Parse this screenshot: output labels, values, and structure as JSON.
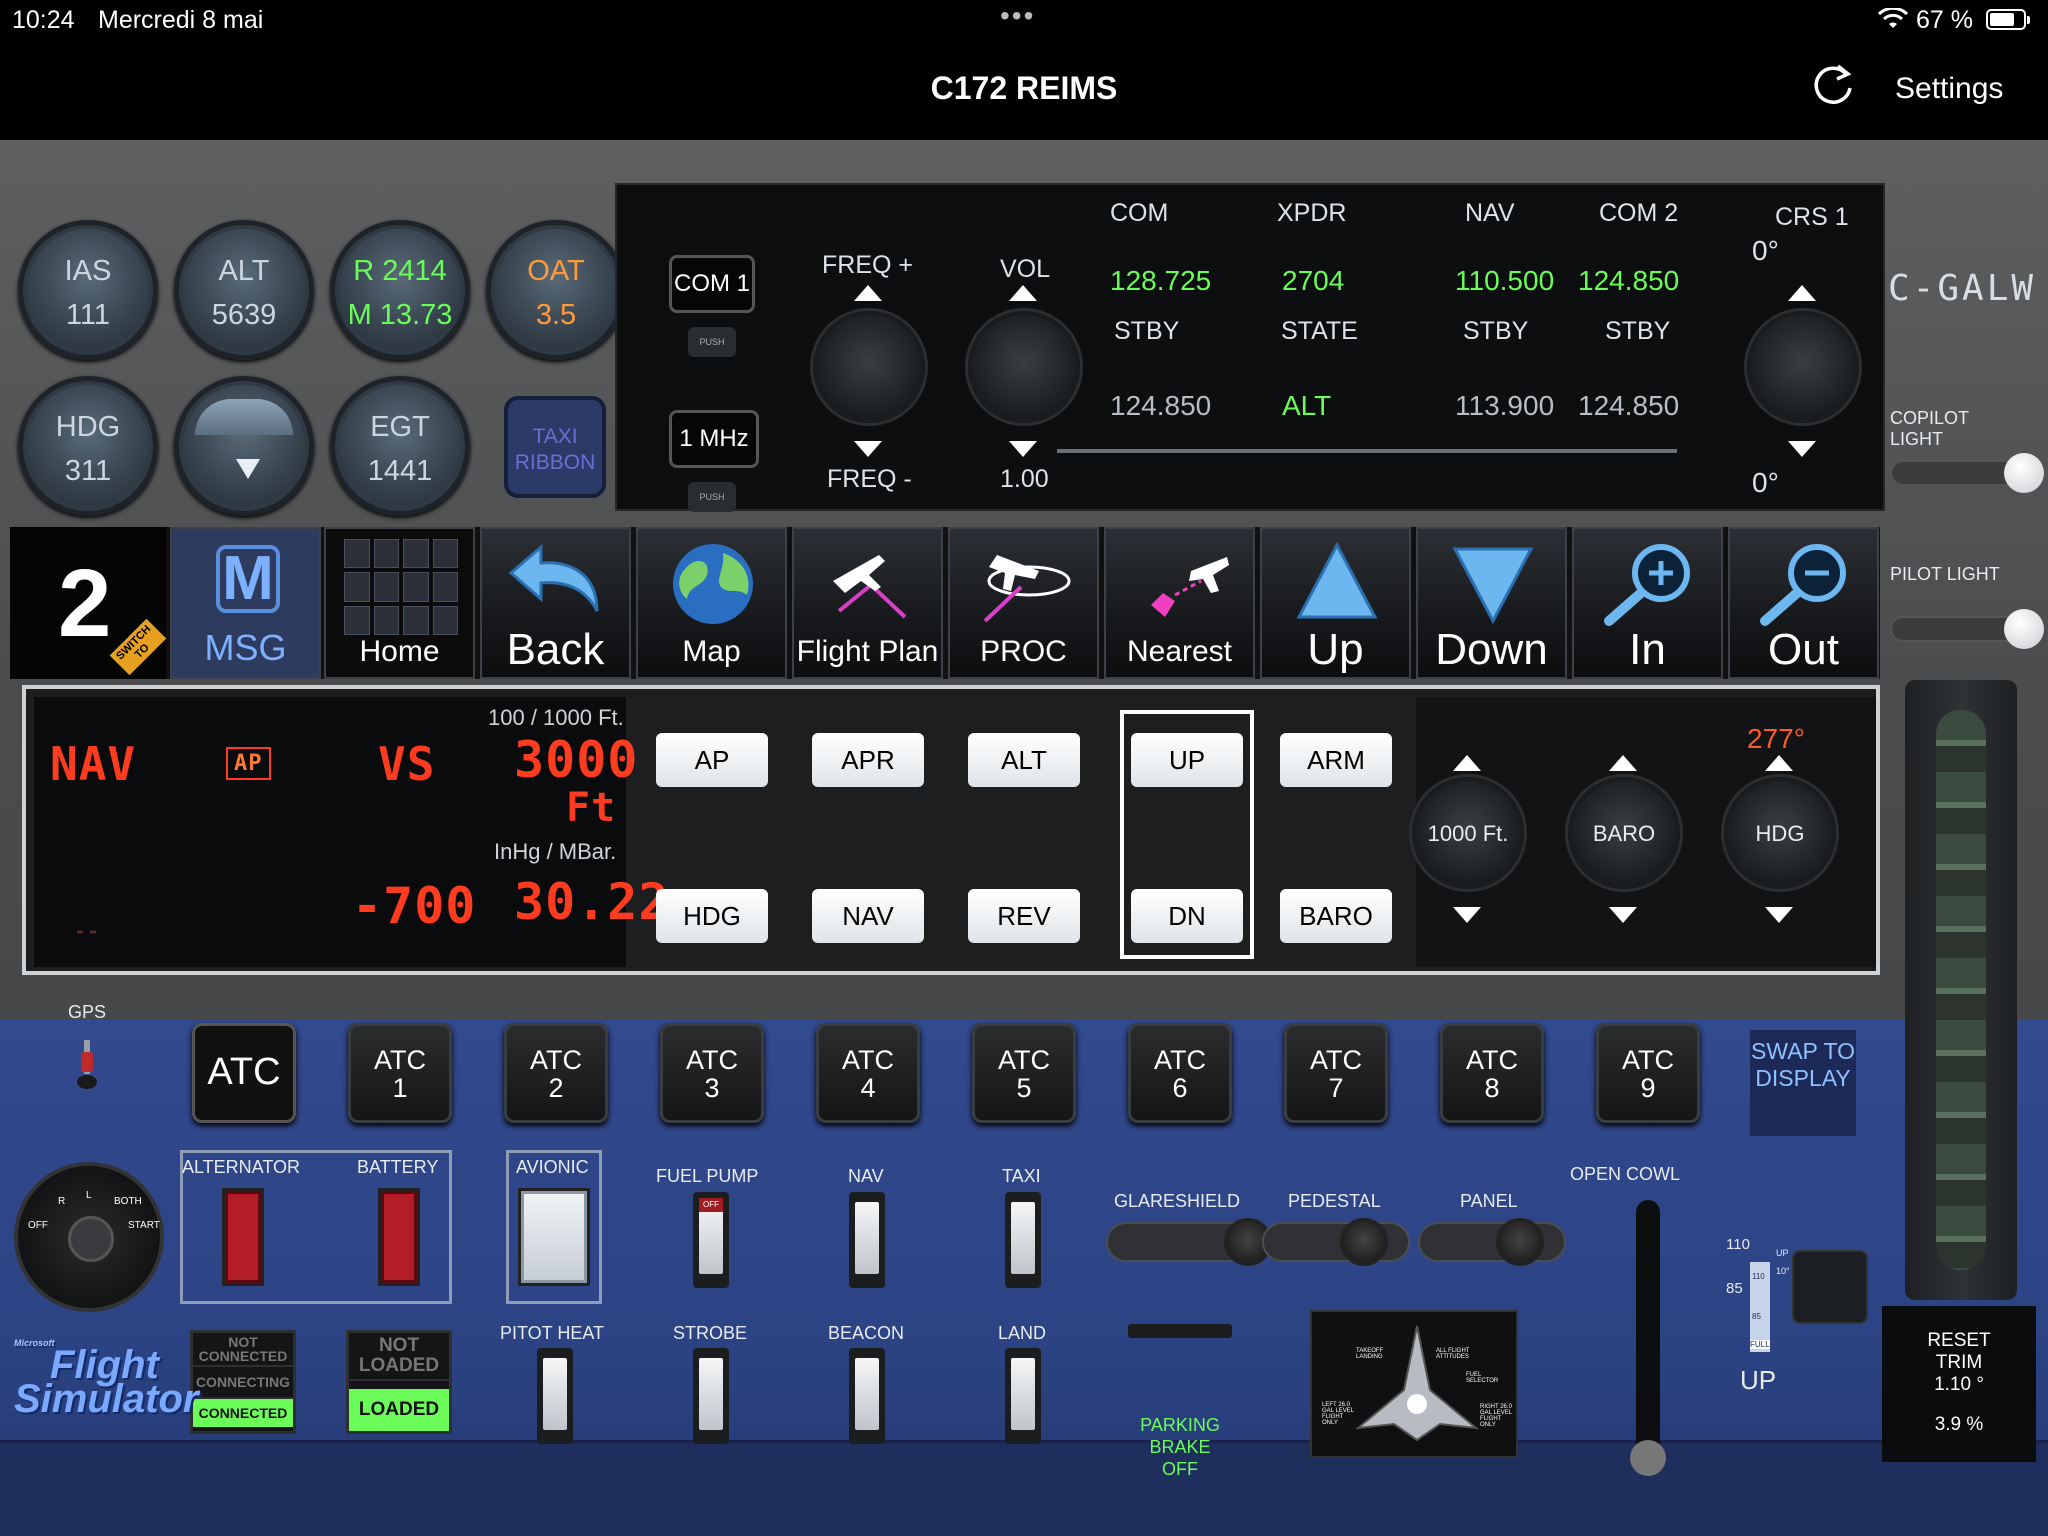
{
  "status": {
    "time": "10:24",
    "date": "Mercredi 8 mai",
    "battery": "67 %"
  },
  "nav": {
    "title": "C172 REIMS",
    "settings": "Settings"
  },
  "gauges": {
    "ias_label": "IAS",
    "ias_value": "111",
    "alt_label": "ALT",
    "alt_value": "5639",
    "r_value": "R 2414",
    "m_value": "M 13.73",
    "oat_label": "OAT",
    "oat_value": "3.5",
    "hdg_label": "HDG",
    "hdg_value": "311",
    "egt_label": "EGT",
    "egt_value": "1441",
    "taxi": "TAXI RIBBON"
  },
  "radio": {
    "com1": "COM 1",
    "push": "PUSH",
    "mhz": "1 MHz",
    "freq_plus": "FREQ +",
    "freq_minus": "FREQ -",
    "vol": "VOL",
    "vol_value": "1.00",
    "headers": [
      "COM",
      "XPDR",
      "NAV",
      "COM 2"
    ],
    "active": [
      "128.725",
      "2704",
      "110.500",
      "124.850"
    ],
    "sub_headers": [
      "STBY",
      "STATE",
      "STBY",
      "STBY"
    ],
    "standby": [
      "124.850",
      "ALT",
      "113.900",
      "124.850"
    ],
    "crs_label": "CRS 1",
    "crs_top": "0°",
    "crs_bottom": "0°",
    "tail": "C-GALW"
  },
  "lights": {
    "copilot": "COPILOT LIGHT",
    "pilot": "PILOT LIGHT"
  },
  "toolbar": {
    "page": "2",
    "switch": "SWITCH TO",
    "msg": "MSG",
    "msg_letter": "M",
    "home": "Home",
    "back": "Back",
    "map": "Map",
    "flight_plan": "Flight Plan",
    "proc": "PROC",
    "nearest": "Nearest",
    "up": "Up",
    "down": "Down",
    "in": "In",
    "out": "Out"
  },
  "autopilot": {
    "mode_nav": "NAV",
    "mode_ap": "AP",
    "mode_vs": "VS",
    "alt_step": "100 / 1000 Ft.",
    "alt_value": "3000",
    "alt_unit": "Ft",
    "baro_unit": "InHg / MBar.",
    "vs_value": "-700",
    "baro_value": "30.22",
    "dashes": "--",
    "buttons_top": [
      "AP",
      "APR",
      "ALT",
      "UP",
      "ARM"
    ],
    "buttons_bottom": [
      "HDG",
      "NAV",
      "REV",
      "DN",
      "BARO"
    ],
    "knob_alt": "1000 Ft.",
    "knob_baro": "BARO",
    "knob_hdg": "HDG",
    "hdg_bug": "277°"
  },
  "atc": {
    "gps": "GPS",
    "main": "ATC",
    "buttons": [
      {
        "l1": "ATC",
        "l2": "1"
      },
      {
        "l1": "ATC",
        "l2": "2"
      },
      {
        "l1": "ATC",
        "l2": "3"
      },
      {
        "l1": "ATC",
        "l2": "4"
      },
      {
        "l1": "ATC",
        "l2": "5"
      },
      {
        "l1": "ATC",
        "l2": "6"
      },
      {
        "l1": "ATC",
        "l2": "7"
      },
      {
        "l1": "ATC",
        "l2": "8"
      },
      {
        "l1": "ATC",
        "l2": "9"
      }
    ],
    "swap": "SWAP TO DISPLAY"
  },
  "switches": {
    "alternator": "ALTERNATOR",
    "battery": "BATTERY",
    "avionic": "AVIONIC",
    "fuel_pump": "FUEL PUMP",
    "off": "OFF",
    "nav": "NAV",
    "taxi": "TAXI",
    "pitot": "PITOT HEAT",
    "strobe": "STROBE",
    "beacon": "BEACON",
    "land": "LAND",
    "glareshield": "GLARESHIELD",
    "pedestal": "PEDESTAL",
    "panel": "PANEL",
    "open_cowl": "OPEN COWL",
    "parking": "PARKING BRAKE OFF"
  },
  "ignition": {
    "off": "OFF",
    "r": "R",
    "l": "L",
    "both": "BOTH",
    "start": "START"
  },
  "connection": {
    "not_connected": "NOT CONNECTED",
    "connecting": "CONNECTING",
    "connected": "CONNECTED",
    "not_loaded": "NOT LOADED",
    "loaded": "LOADED"
  },
  "brand": {
    "small": "Microsoft",
    "line1": "Flight",
    "line2": "Simulator"
  },
  "fuel_selector": {
    "takeoff": "TAKEOFF LANDING",
    "all_flight": "ALL FLIGHT ATTITUDES",
    "fuel_selector": "FUEL SELECTOR",
    "left": "LEFT 26.0 GAL LEVEL FLIGHT ONLY",
    "right": "RIGHT 26.0 GAL LEVEL FLIGHT ONLY"
  },
  "flaps": {
    "n110": "110",
    "n85": "85",
    "up": "UP",
    "full": "FULL",
    "scale_110": "110",
    "scale_85": "85",
    "tick_up": "UP",
    "tick_10": "10°"
  },
  "trim": {
    "reset": "RESET TRIM",
    "deg": "1.10 °",
    "pct": "3.9 %"
  }
}
